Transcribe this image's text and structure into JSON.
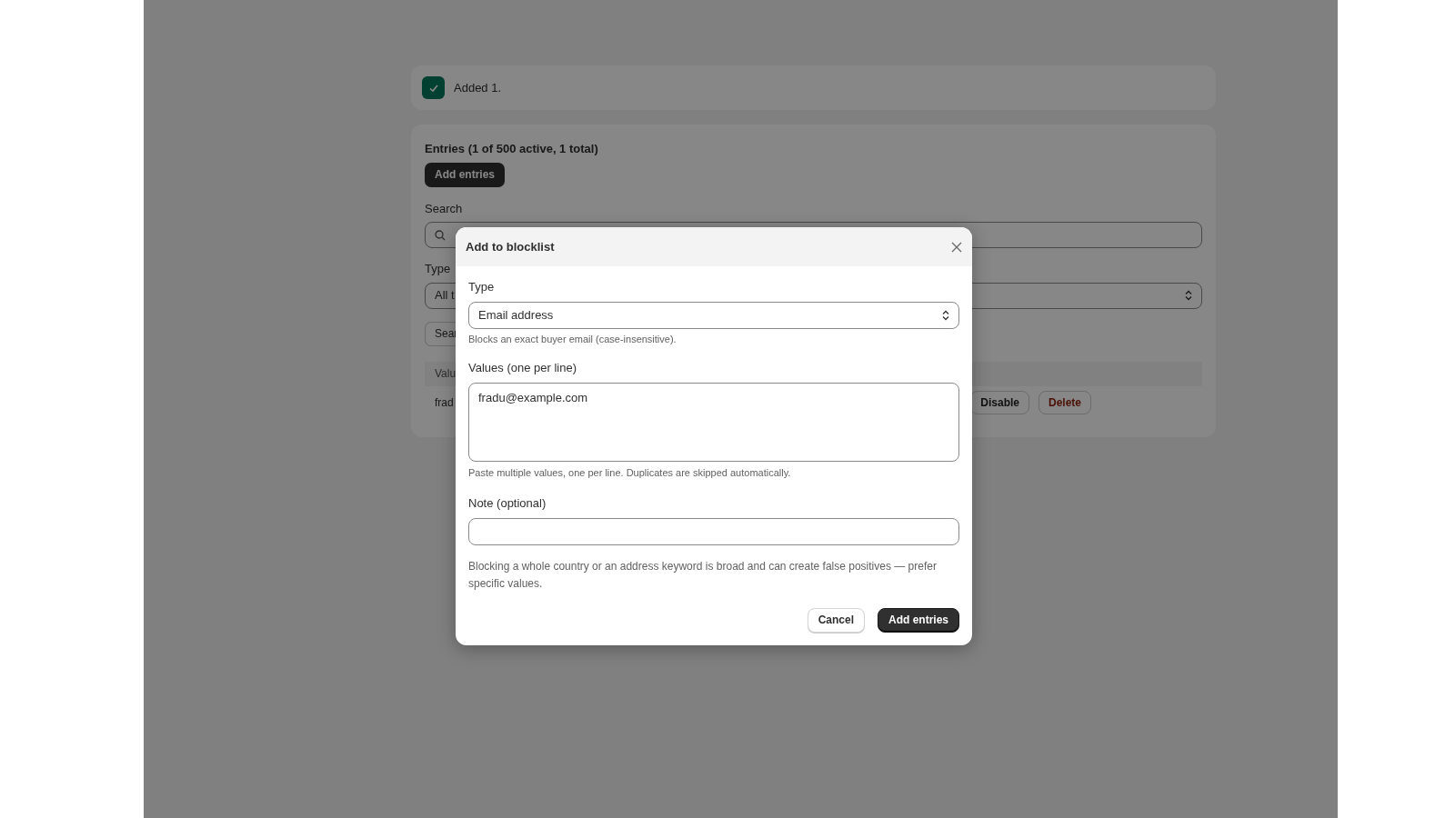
{
  "toast": {
    "message": "Added 1."
  },
  "entries": {
    "title": "Entries (1 of 500 active, 1 total)",
    "add_button": "Add entries",
    "search": {
      "label": "Search"
    },
    "type_filter": {
      "label": "Type",
      "value": "All t"
    },
    "search_button": "Sear",
    "table": {
      "columns": [
        "Valu"
      ],
      "rows": [
        {
          "cells": [
            "frad"
          ],
          "actions": [
            {
              "label": "Disable",
              "kind": "default"
            },
            {
              "label": "Delete",
              "kind": "danger"
            }
          ]
        }
      ]
    }
  },
  "dialog": {
    "title": "Add to blocklist",
    "type": {
      "label": "Type",
      "value": "Email address",
      "help": "Blocks an exact buyer email (case-insensitive)."
    },
    "values": {
      "label": "Values (one per line)",
      "value": "fradu@example.com",
      "help": "Paste multiple values, one per line. Duplicates are skipped automatically."
    },
    "note": {
      "label": "Note (optional)"
    },
    "warning": "Blocking a whole country or an address keyword is broad and can create false positives — prefer specific values.",
    "buttons": [
      {
        "label": "Cancel",
        "kind": "secondary"
      },
      {
        "label": "Add entries",
        "kind": "primary"
      }
    ]
  }
}
